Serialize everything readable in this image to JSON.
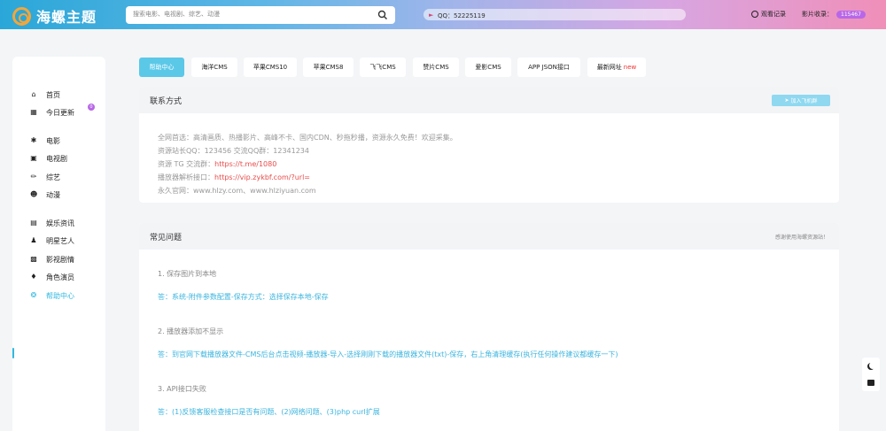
{
  "header": {
    "logo_text": "海螺主题",
    "search_placeholder": "搜索电影、电视剧、综艺、动漫",
    "notice": "QQ：52225119",
    "history_label": "观看记录",
    "count_label": "影片收录：",
    "count_value": "115467"
  },
  "sidebar": {
    "items": [
      {
        "label": "首页",
        "icon": "home-icon"
      },
      {
        "label": "今日更新",
        "icon": "calendar-icon",
        "badge": "0"
      },
      {
        "label": "电影",
        "icon": "film-icon"
      },
      {
        "label": "电视剧",
        "icon": "tv-icon"
      },
      {
        "label": "综艺",
        "icon": "mic-icon"
      },
      {
        "label": "动漫",
        "icon": "anime-icon"
      },
      {
        "label": "娱乐资讯",
        "icon": "news-icon"
      },
      {
        "label": "明星艺人",
        "icon": "star-person-icon"
      },
      {
        "label": "影视剧情",
        "icon": "clapper-icon"
      },
      {
        "label": "角色演员",
        "icon": "role-icon"
      },
      {
        "label": "帮助中心",
        "icon": "help-icon",
        "active": true
      }
    ]
  },
  "tabs": [
    {
      "label": "帮助中心",
      "active": true
    },
    {
      "label": "海洋CMS"
    },
    {
      "label": "苹果CMS10"
    },
    {
      "label": "苹果CMS8"
    },
    {
      "label": "飞飞CMS"
    },
    {
      "label": "赞片CMS"
    },
    {
      "label": "爱影CMS"
    },
    {
      "label": "APP JSON接口"
    },
    {
      "label": "最新网址",
      "suffix": "new"
    }
  ],
  "contact": {
    "title": "联系方式",
    "tg_button": "加入飞机群",
    "lines": [
      {
        "text": "全网首选：高清画质、热播影片、高峰不卡、国内CDN、秒拖秒播，资源永久免费！欢迎采集。"
      },
      {
        "text": "资源站长QQ：123456 交流QQ群：12341234"
      },
      {
        "text": "资源 TG 交流群：",
        "link": "https://t.me/1080"
      },
      {
        "text": "播放器解析接口：",
        "link": "https://vip.zykbf.com/?url="
      },
      {
        "text": "永久官网：www.hlzy.com、www.hlziyuan.com"
      }
    ]
  },
  "faq": {
    "title": "常见问题",
    "note": "感谢使用海螺资源站！",
    "items": [
      {
        "q": "1. 保存图片到本地",
        "a": "答：系统-附件参数配置-保存方式：选择保存本地-保存"
      },
      {
        "q": "2. 播放器添加不显示",
        "a": "答：到官网下载播放器文件-CMS后台点击视频-播放器-导入-选择刚刚下载的播放器文件(txt)-保存，右上角清理缓存(执行任何操作建议都缓存一下)"
      },
      {
        "q": "3. API接口失败",
        "a": "答：(1)反馈客服检查接口是否有问题、(2)网络问题、(3)php curl扩展"
      }
    ]
  },
  "colors": {
    "accent": "#32b8e0",
    "badge": "#b867e8",
    "link_red": "#e94b4b"
  }
}
